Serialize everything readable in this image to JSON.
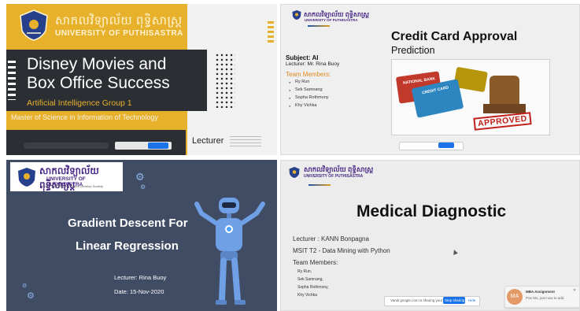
{
  "panel1": {
    "university_kh": "សាកលវិទ្យាល័យ ពុទ្ធិសាស្ត្រ",
    "university_en": "UNIVERSITY OF PUTHISASTRA",
    "title_line1": "Disney Movies and",
    "title_line2": "Box Office Success",
    "subtitle": "Artificial Intelligence Group 1",
    "program": "Master of Science in Information of Technology",
    "lecturer": "Lecturer"
  },
  "panel2": {
    "university_kh": "សាកលវិទ្យាល័យ ពុទ្ធិសាស្ត្រ",
    "university_en": "UNIVERSITY OF PUTHISASTRA",
    "title": "Credit Card Approval",
    "title2": "Prediction",
    "subject": "Subject: AI",
    "lecturer": "Lecturer: Mr. Rina Buoy",
    "team_label": "Team Members:",
    "members": [
      "Ry Run",
      "Sek Samnang",
      "Sopha Rothmony",
      "Khy Vichka"
    ],
    "card_text_1": "NATIONAL BANK",
    "card_text_2": "CREDIT CARD",
    "stamp_text": "APPROVED"
  },
  "panel3": {
    "university_kh": "សាកលវិទ្យាល័យ ពុទ្ធិសាស្ត្រ",
    "university_en": "UNIVERSITY OF PUTHISASTRA",
    "motto": "Honor Self    Respect Others    Develop Society",
    "title_line1": "Gradient Descent For",
    "title_line2": "Linear Regression",
    "lecturer": "Lecturer: Rina Buoy",
    "date": "Date: 15-Nov-2020"
  },
  "panel4": {
    "university_kh": "សាកលវិទ្យាល័យ ពុទ្ធិសាស្ត្រ",
    "university_en": "UNIVERSITY OF PUTHISASTRA",
    "title": "Medical Diagnostic",
    "lecturer": "Lecturer   : KANN Bonpagna",
    "course": "MSIT T2 - Data Mining with Python",
    "team_label": "Team Members:",
    "members": [
      "Ry Run,",
      "Sek Samnang,",
      "Sopha Rothmony,",
      "Khy Vichka"
    ],
    "share_text": "Vandi google.com is sharing your screen.",
    "stop_label": "Stop sharing",
    "hide_label": "Hide",
    "notif_avatar": "MA",
    "notif_title": "MBA Assignment",
    "notif_body": "Poe Mo, just now to add"
  },
  "colors": {
    "accent_yellow": "#e8b12c",
    "dark_slate": "#2b2e33",
    "navy_slide": "#404c64",
    "brand_purple": "#4a2a86",
    "stamp_red": "#c0201a",
    "share_blue": "#1a73e8"
  }
}
